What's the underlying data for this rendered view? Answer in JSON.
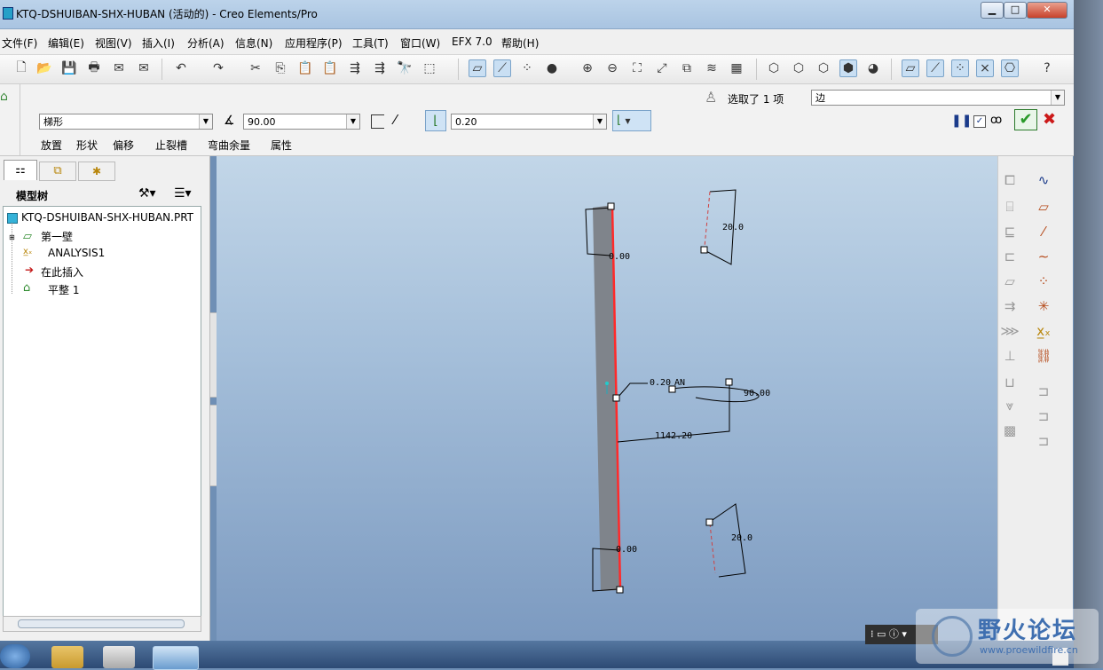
{
  "window": {
    "title": "KTQ-DSHUIBAN-SHX-HUBAN (活动的) - Creo Elements/Pro",
    "minimize": "▁",
    "maximize": "□",
    "close": "✕"
  },
  "menu": [
    "文件(F)",
    "编辑(E)",
    "视图(V)",
    "插入(I)",
    "分析(A)",
    "信息(N)",
    "应用程序(P)",
    "工具(T)",
    "窗口(W)",
    "EFX 7.0",
    "帮助(H)"
  ],
  "dashboard": {
    "shape_value": "梯形",
    "angle_value": "90.00",
    "thickness_value": "0.20",
    "selected_label": "选取了 1 项",
    "filter_value": "边",
    "tabs": [
      "放置",
      "形状",
      "偏移",
      "止裂槽",
      "弯曲余量",
      "属性"
    ]
  },
  "model_tree": {
    "title": "模型树",
    "root": "KTQ-DSHUIBAN-SHX-HUBAN.PRT",
    "items": [
      "第一壁",
      "ANALYSIS1",
      "在此插入",
      "平整 1"
    ]
  },
  "dimensions": {
    "top_length": "0.00",
    "top_angle": "20.0",
    "mid_thickness": "0.20",
    "mid_label": "AN",
    "mid_angle": "90.00",
    "mid_length": "1142.20",
    "bottom_length": "0.00",
    "bottom_angle": "20.0"
  },
  "watermark": {
    "site_name": "野火论坛",
    "url": "www.proewildfire.cn"
  },
  "colors": {
    "edge_highlight": "#ff2a2a",
    "accept_green": "#2a9a2a",
    "cancel_red": "#cc1a1a",
    "viewport_top": "#c2d6e8",
    "viewport_bottom": "#7c9ac0"
  },
  "icons": [
    "new-icon",
    "open-icon",
    "save-icon",
    "print-icon",
    "undo-icon",
    "redo-icon",
    "cut-icon",
    "copy-icon",
    "paste-icon",
    "zoom-in-icon",
    "zoom-out-icon",
    "refit-icon",
    "pause-icon",
    "preview-icon",
    "accept-icon",
    "cancel-icon",
    "help-icon"
  ]
}
